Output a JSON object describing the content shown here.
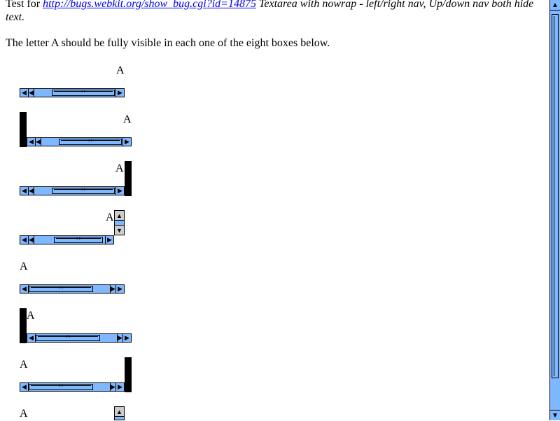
{
  "intro": {
    "prefix": "Test for ",
    "link_text": "http://bugs.webkit.org/show_bug.cgi?id=14875",
    "suffix": " Textarea with nowrap - left/right nav, Up/down nav both hide text."
  },
  "instruction": "The letter A should be fully visible in each one of the eight boxes below.",
  "boxes": [
    {
      "letter": "A"
    },
    {
      "letter": "A"
    },
    {
      "letter": "A"
    },
    {
      "letter": "A"
    },
    {
      "letter": "A"
    },
    {
      "letter": "A"
    },
    {
      "letter": "A"
    },
    {
      "letter": "A"
    }
  ],
  "icons": {
    "left": "◀",
    "right": "▶",
    "up": "▲",
    "down": "▼"
  },
  "colors": {
    "scrollbar": "#80b8ff",
    "link": "#0000ee"
  }
}
